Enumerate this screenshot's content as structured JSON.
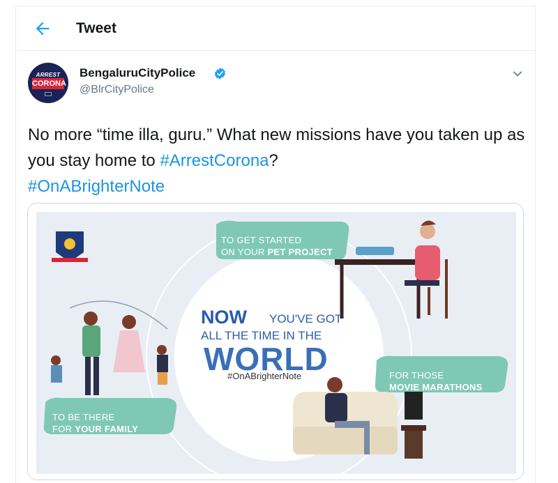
{
  "header": {
    "title": "Tweet",
    "back_icon": "arrow-left-icon"
  },
  "tweet": {
    "author_name": "BengaluruCityPolice",
    "handle": "@BlrCityPolice",
    "verified_icon": "verified-badge-icon",
    "menu_icon": "chevron-down-icon",
    "avatar": {
      "line1": "ARREST",
      "line2": "CORONA"
    },
    "text_part1": "No more “time illa, guru.” What new missions have you taken up as you stay home to ",
    "hashtag1": "#ArrestCorona",
    "text_part2": "?",
    "hashtag2": "#OnABrighterNote"
  },
  "media": {
    "label_pet_line1": "TO GET STARTED",
    "label_pet_line2_prefix": "ON YOUR ",
    "label_pet_line2_bold": "PET PROJECT",
    "headline_now": "NOW",
    "headline_youve_got": "YOU'VE GOT",
    "headline_all_the": "ALL THE TIME",
    "headline_in_the": "IN THE",
    "headline_world": "WORLD",
    "headline_hashtag": "#OnABrighterNote",
    "label_movie_line1": "FOR THOSE",
    "label_movie_line2": "MOVIE MARATHONS",
    "label_family_line1": "TO BE THERE",
    "label_family_line2_prefix": "FOR ",
    "label_family_line2_bold": "YOUR FAMILY"
  },
  "colors": {
    "link": "#1b95e0",
    "verified": "#1da1f2",
    "teal_label": "#7fc8b6",
    "headline_blue": "#2b5ca6",
    "art_background": "#e9eef5"
  }
}
